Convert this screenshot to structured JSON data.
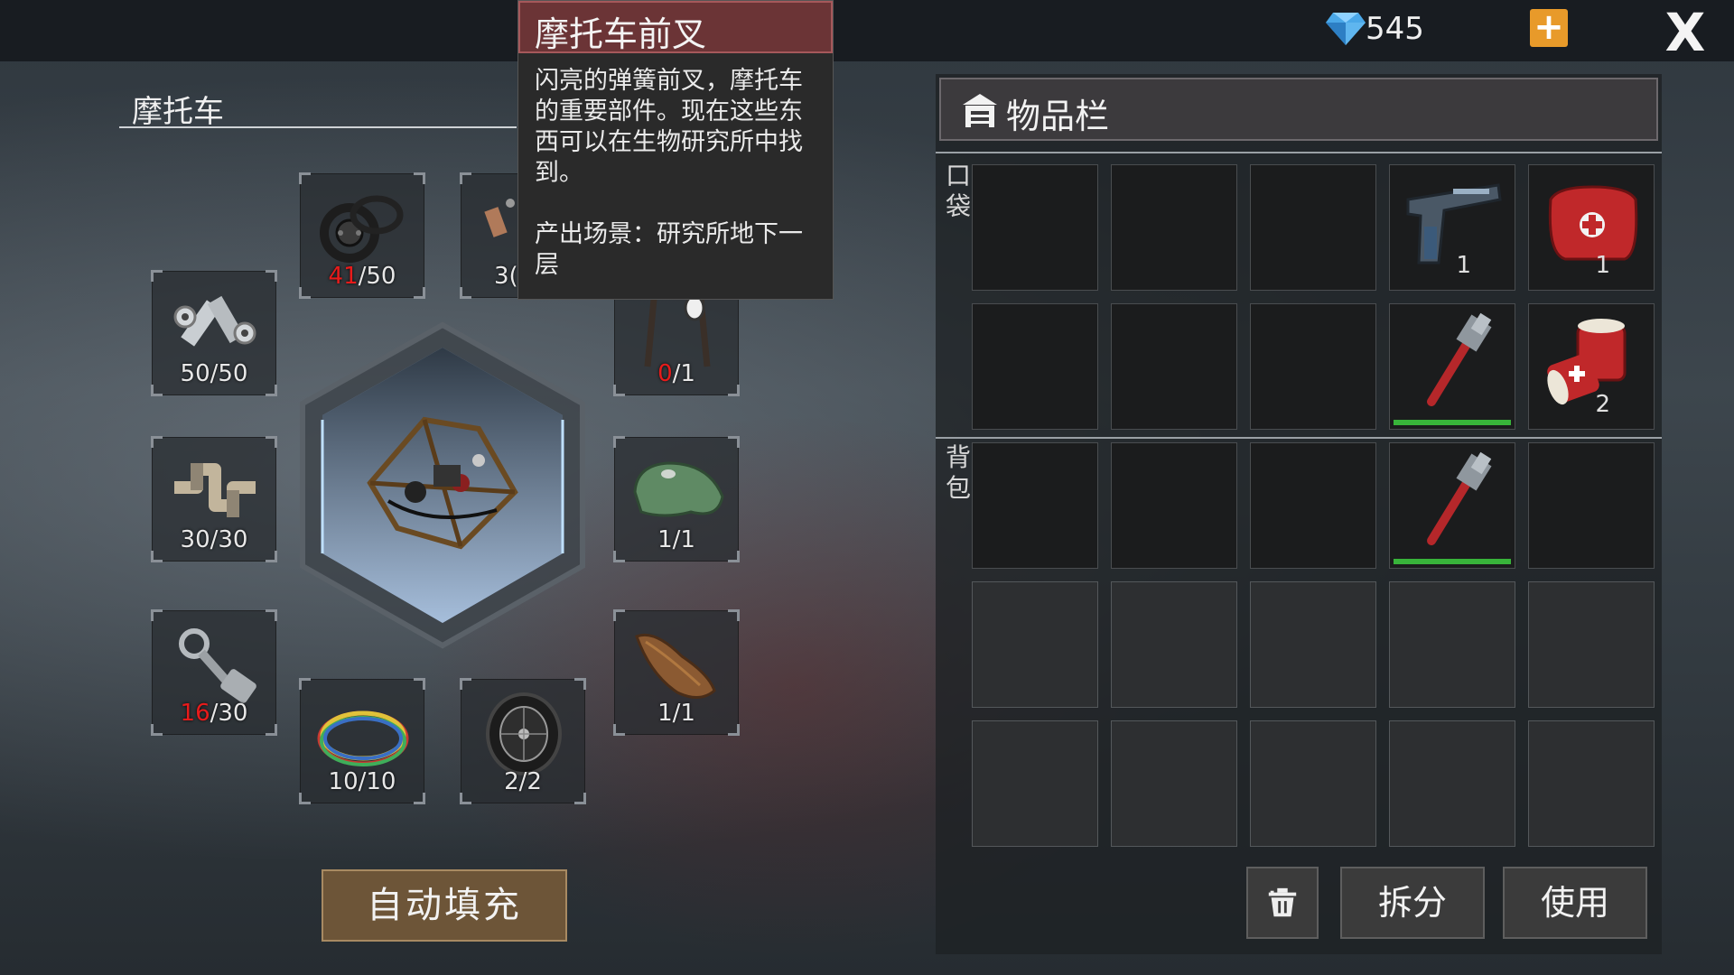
{
  "currency": {
    "gems": "545",
    "gem_icon": "diamond-icon"
  },
  "vehicle": {
    "title": "摩托车"
  },
  "parts": [
    {
      "id": "gaskets",
      "icon": "gasket-rings-icon",
      "have": "41",
      "need": "/50",
      "low": true
    },
    {
      "id": "part-2",
      "icon": "part-icon",
      "have": "3(",
      "need": "",
      "low": false
    },
    {
      "id": "bolts",
      "icon": "bolts-nuts-icon",
      "have": "50",
      "need": "/50",
      "low": false
    },
    {
      "id": "front-fork",
      "icon": "front-fork-icon",
      "have": "0",
      "need": "/1",
      "low": true
    },
    {
      "id": "crankshaft",
      "icon": "crankshaft-icon",
      "have": "30",
      "need": "/30",
      "low": false
    },
    {
      "id": "fuel-tank",
      "icon": "fuel-tank-icon",
      "have": "1",
      "need": "/1",
      "low": false
    },
    {
      "id": "piston",
      "icon": "piston-icon",
      "have": "16",
      "need": "/30",
      "low": true
    },
    {
      "id": "seat",
      "icon": "seat-icon",
      "have": "1",
      "need": "/1",
      "low": false
    },
    {
      "id": "wires",
      "icon": "wire-bundle-icon",
      "have": "10",
      "need": "/10",
      "low": false
    },
    {
      "id": "wheel",
      "icon": "wheel-icon",
      "have": "2",
      "need": "/2",
      "low": false
    }
  ],
  "tooltip": {
    "title": "摩托车前叉",
    "description": "闪亮的弹簧前叉，摩托车的重要部件。现在这些东西可以在生物研究所中找到。",
    "source": "产出场景：研究所地下一层"
  },
  "autofill_label": "自动填充",
  "inventory": {
    "title": "物品栏",
    "pocket_label": "口袋",
    "backpack_label": "背包",
    "items": {
      "pistol_qty": "1",
      "medkit_qty": "1",
      "bandage_qty": "2"
    },
    "durability": {
      "wrench_1": 1.0,
      "wrench_2": 1.0
    },
    "split_label": "拆分",
    "use_label": "使用"
  }
}
